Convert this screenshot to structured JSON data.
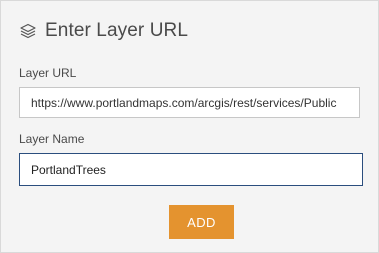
{
  "dialog": {
    "title": "Enter Layer URL",
    "icon": "layers-icon"
  },
  "form": {
    "layer_url": {
      "label": "Layer URL",
      "value": "https://www.portlandmaps.com/arcgis/rest/services/Public"
    },
    "layer_name": {
      "label": "Layer Name",
      "value": "PortlandTrees"
    },
    "add_label": "ADD"
  },
  "colors": {
    "accent": "#E4932F",
    "focus_border": "#2B4E7E",
    "panel_bg": "#F4F4F4",
    "text": "#4A4A4A"
  }
}
